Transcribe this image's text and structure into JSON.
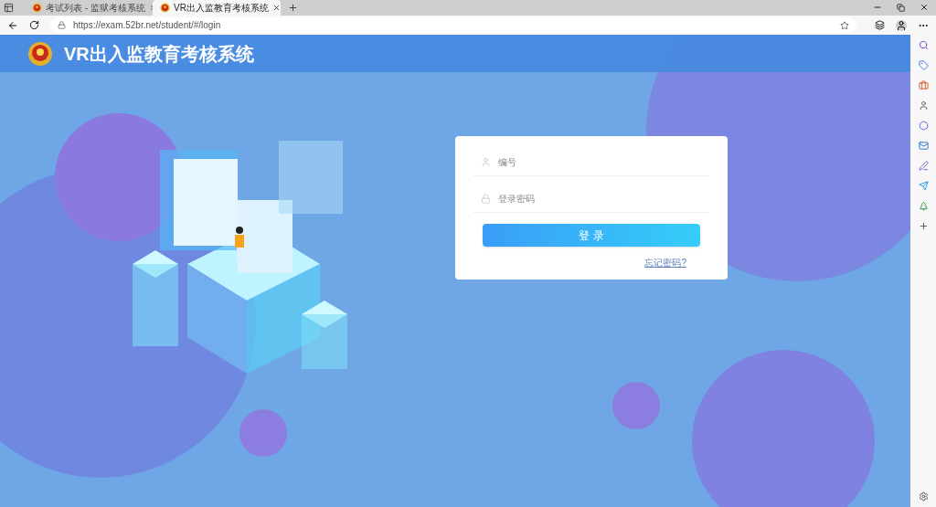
{
  "browser": {
    "tabs": [
      {
        "title": "考试列表 - 监狱考核系统",
        "selected": false
      },
      {
        "title": "VR出入监教育考核系统",
        "selected": true
      }
    ],
    "url": "https://exam.52br.net/student/#/login"
  },
  "header": {
    "title": "VR出入监教育考核系统"
  },
  "login": {
    "username": {
      "placeholder": "编号"
    },
    "password": {
      "placeholder": "登录密码"
    },
    "submit": "登 录",
    "forgot": "忘记密码?"
  }
}
